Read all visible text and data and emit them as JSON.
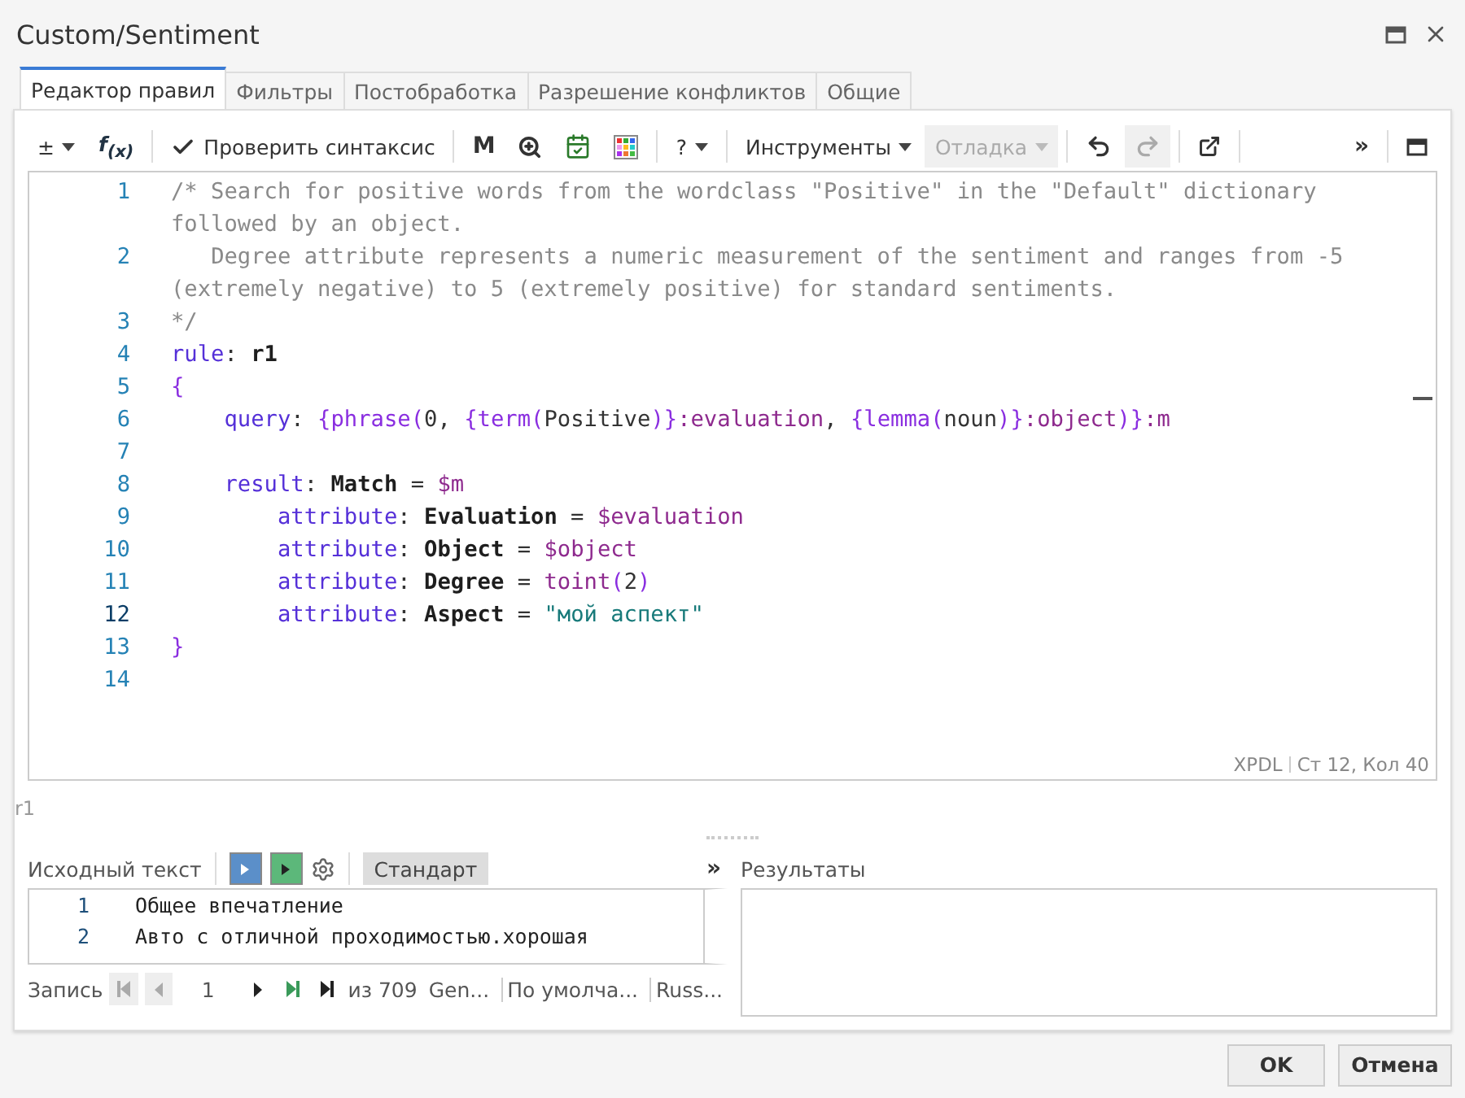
{
  "window": {
    "title": "Custom/Sentiment"
  },
  "tabs": [
    {
      "label": "Редактор правил",
      "selected": true
    },
    {
      "label": "Фильтры",
      "selected": false
    },
    {
      "label": "Постобработка",
      "selected": false
    },
    {
      "label": "Разрешение конфликтов",
      "selected": false
    },
    {
      "label": "Общие",
      "selected": false
    }
  ],
  "toolbar": [
    {
      "kind": "text-dropdown",
      "label": "±",
      "disabled": false
    },
    {
      "kind": "rich",
      "label": "f$_{(x)}$",
      "disabled": false
    },
    {
      "kind": "sep"
    },
    {
      "kind": "check-button",
      "label": "Проверить синтаксис",
      "disabled": false
    },
    {
      "kind": "sep"
    },
    {
      "kind": "bold-text",
      "label": "M",
      "disabled": false
    },
    {
      "kind": "zoom",
      "disabled": false
    },
    {
      "kind": "calendar",
      "disabled": false
    },
    {
      "kind": "grid",
      "disabled": false
    },
    {
      "kind": "sep"
    },
    {
      "kind": "text-dropdown",
      "label": "?",
      "disabled": false
    },
    {
      "kind": "sep"
    },
    {
      "kind": "text-dropdown",
      "label": "Инструменты",
      "disabled": false
    },
    {
      "kind": "text-dropdown",
      "label": "Отладка",
      "disabled": true
    },
    {
      "kind": "sep"
    },
    {
      "kind": "undo",
      "disabled": false
    },
    {
      "kind": "redo",
      "disabled": true
    },
    {
      "kind": "sep"
    },
    {
      "kind": "external",
      "disabled": false
    },
    {
      "kind": "sep"
    },
    {
      "kind": "spacer"
    },
    {
      "kind": "bold-text",
      "label": "»",
      "disabled": false
    },
    {
      "kind": "sep"
    },
    {
      "kind": "maximize",
      "disabled": false
    }
  ],
  "editor": {
    "lines": [
      {
        "num": "1",
        "current": false,
        "tokens": [
          {
            "kind": "comment",
            "t": "/* Search for positive words from the wordclass \"Positive\" in the \"Default\" dictionary followed by an object."
          }
        ]
      },
      {
        "num": "2",
        "current": false,
        "tokens": [
          {
            "kind": "comment",
            "t": "   Degree attribute represents a numeric measurement of the sentiment and ranges from -5 (extremely negative) to 5 (extremely positive) for standard sentiments."
          }
        ]
      },
      {
        "num": "3",
        "current": false,
        "tokens": [
          {
            "kind": "comment",
            "t": "*/"
          }
        ]
      },
      {
        "num": "4",
        "current": false,
        "tokens": [
          {
            "kind": "keyword",
            "t": "rule"
          },
          {
            "kind": "plain",
            "t": ": "
          },
          {
            "kind": "name",
            "t": "r1"
          }
        ]
      },
      {
        "num": "5",
        "current": false,
        "tokens": [
          {
            "kind": "brace",
            "t": "{"
          }
        ]
      },
      {
        "num": "6",
        "current": false,
        "tokens": [
          {
            "kind": "keyword",
            "t": "    query"
          },
          {
            "kind": "plain",
            "t": ": "
          },
          {
            "kind": "brace",
            "t": "{phrase("
          },
          {
            "kind": "plain",
            "t": "0, "
          },
          {
            "kind": "brace",
            "t": "{term("
          },
          {
            "kind": "plain",
            "t": "Positive"
          },
          {
            "kind": "brace",
            "t": ")}"
          },
          {
            "kind": "var",
            "t": ":evaluation"
          },
          {
            "kind": "plain",
            "t": ", "
          },
          {
            "kind": "brace",
            "t": "{lemma("
          },
          {
            "kind": "plain",
            "t": "noun"
          },
          {
            "kind": "brace",
            "t": ")}"
          },
          {
            "kind": "var",
            "t": ":object"
          },
          {
            "kind": "brace",
            "t": ")}"
          },
          {
            "kind": "var",
            "t": ":m"
          }
        ]
      },
      {
        "num": "7",
        "current": false
      },
      {
        "num": "8",
        "current": false,
        "tokens": [
          {
            "kind": "keyword",
            "t": "    result"
          },
          {
            "kind": "plain",
            "t": ": "
          },
          {
            "kind": "name",
            "t": "Match"
          },
          {
            "kind": "plain",
            "t": " = "
          },
          {
            "kind": "var",
            "t": "$m"
          }
        ]
      },
      {
        "num": "9",
        "current": false,
        "tokens": [
          {
            "kind": "keyword",
            "t": "        attribute"
          },
          {
            "kind": "plain",
            "t": ": "
          },
          {
            "kind": "name",
            "t": "Evaluation"
          },
          {
            "kind": "plain",
            "t": " = "
          },
          {
            "kind": "var",
            "t": "$evaluation"
          }
        ]
      },
      {
        "num": "10",
        "current": false,
        "tokens": [
          {
            "kind": "keyword",
            "t": "        attribute"
          },
          {
            "kind": "plain",
            "t": ": "
          },
          {
            "kind": "name",
            "t": "Object"
          },
          {
            "kind": "plain",
            "t": " = "
          },
          {
            "kind": "var",
            "t": "$object"
          }
        ]
      },
      {
        "num": "11",
        "current": false,
        "tokens": [
          {
            "kind": "keyword",
            "t": "        attribute"
          },
          {
            "kind": "plain",
            "t": ": "
          },
          {
            "kind": "name",
            "t": "Degree"
          },
          {
            "kind": "plain",
            "t": " = "
          },
          {
            "kind": "var",
            "t": "toint"
          },
          {
            "kind": "brace",
            "t": "("
          },
          {
            "kind": "plain",
            "t": "2"
          },
          {
            "kind": "brace",
            "t": ")"
          }
        ]
      },
      {
        "num": "12",
        "current": true,
        "tokens": [
          {
            "kind": "keyword",
            "t": "        attribute"
          },
          {
            "kind": "plain",
            "t": ": "
          },
          {
            "kind": "name",
            "t": "Aspect"
          },
          {
            "kind": "plain",
            "t": " = "
          },
          {
            "kind": "string",
            "t": "\"мой аспект\""
          }
        ]
      },
      {
        "num": "13",
        "current": false,
        "tokens": [
          {
            "kind": "brace",
            "t": "}"
          }
        ]
      },
      {
        "num": "14",
        "current": false
      }
    ],
    "language": "XPDL",
    "position": "Ст 12, Кол 40"
  },
  "rule_name": "r1",
  "source": {
    "title": "Исходный текст",
    "mode": {
      "label": "Стандарт",
      "selected": true
    },
    "more": "»",
    "lines": [
      {
        "num": "1",
        "text": "Общее впечатление"
      },
      {
        "num": "2",
        "text": "Авто с отличной проходимостью.хорошая"
      }
    ],
    "nav": {
      "label": "Запись",
      "current": "1",
      "total": "из 709",
      "fields": [
        "Gen...",
        "По умолча...",
        "Russ..."
      ]
    }
  },
  "results": {
    "title": "Результаты"
  },
  "buttons": [
    {
      "label": "OK",
      "kind": "primary"
    },
    {
      "label": "Отмена",
      "kind": "secondary"
    }
  ]
}
